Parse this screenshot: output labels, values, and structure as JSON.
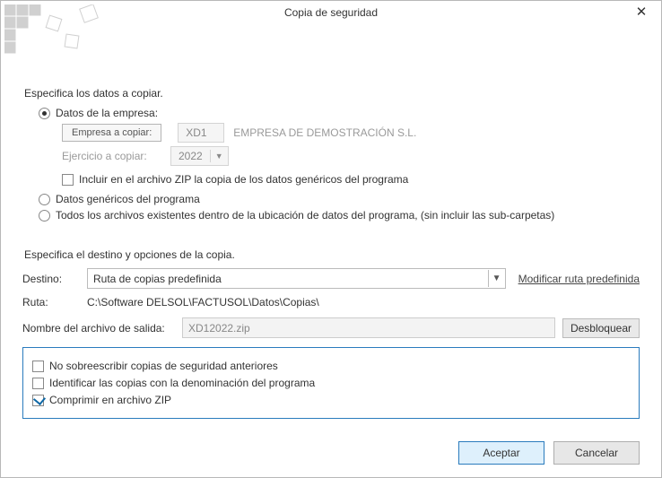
{
  "title": "Copia de seguridad",
  "section1": {
    "heading": "Especifica los datos a copiar.",
    "opt_company_label": "Datos de la empresa:",
    "company_copy_btn": "Empresa a copiar:",
    "company_code": "XD1",
    "company_name": "EMPRESA DE DEMOSTRACIÓN S.L.",
    "exercise_label": "Ejercicio a copiar:",
    "exercise_year": "2022",
    "include_generic_label": "Incluir en el archivo ZIP la copia de los datos genéricos del programa",
    "opt_generic_label": "Datos genéricos del programa",
    "opt_all_label": "Todos los archivos existentes dentro de la ubicación de datos del programa, (sin incluir las sub-carpetas)"
  },
  "section2": {
    "heading": "Especifica el destino y opciones de la copia.",
    "dest_label": "Destino:",
    "dest_value": "Ruta de copias predefinida",
    "modify_link": "Modificar ruta predefinida",
    "path_label": "Ruta:",
    "path_value": "C:\\Software DELSOL\\FACTUSOL\\Datos\\Copias\\",
    "outname_label": "Nombre del archivo de salida:",
    "outname_value": "XD12022.zip",
    "unlock_btn": "Desbloquear",
    "chk_nooverwrite": "No sobreescribir copias de seguridad anteriores",
    "chk_identify": "Identificar las copias con la denominación del programa",
    "chk_compress": "Comprimir en archivo ZIP"
  },
  "footer": {
    "accept": "Aceptar",
    "cancel": "Cancelar"
  }
}
